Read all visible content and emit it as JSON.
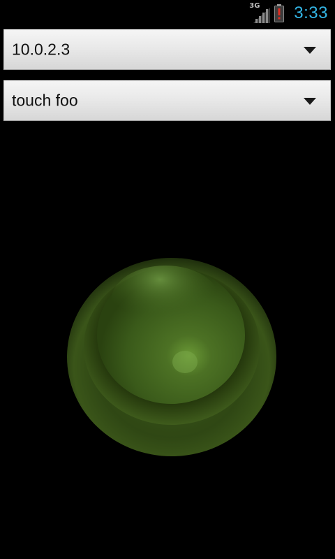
{
  "status_bar": {
    "network_type": "3G",
    "time": "3:33",
    "icons": [
      "signal-icon",
      "battery-alert-icon"
    ],
    "colors": {
      "clock": "#33b5e5",
      "battery_alert": "#e02b20"
    }
  },
  "spinners": [
    {
      "selected_value": "10.0.2.3"
    },
    {
      "selected_value": "touch foo"
    }
  ],
  "touch_button": {
    "icon": "green-round-button",
    "color": "#4a6a22"
  }
}
